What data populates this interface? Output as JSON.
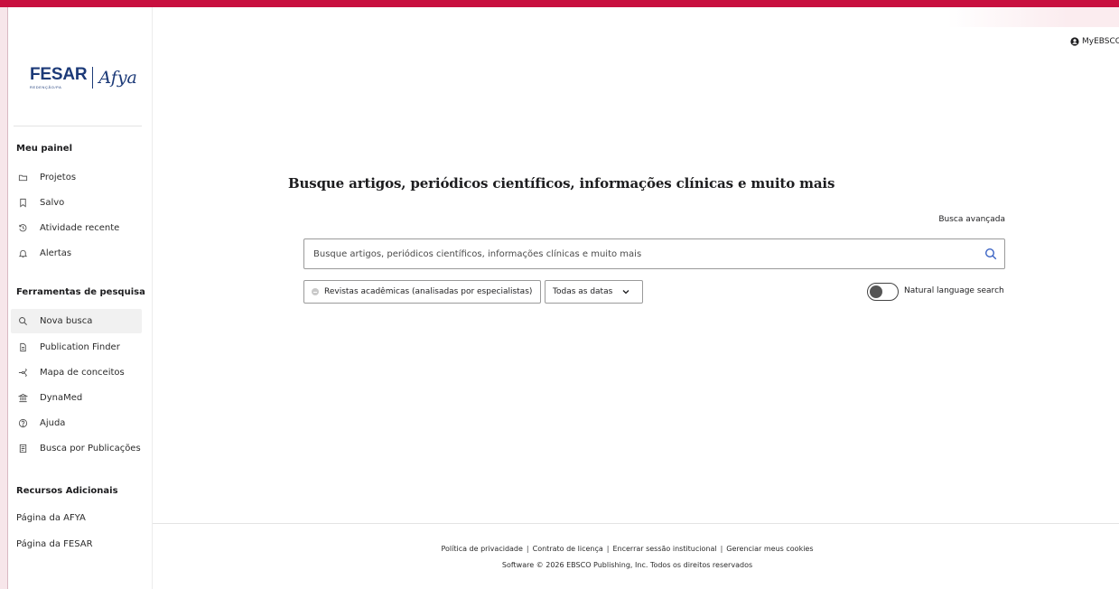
{
  "brand": {
    "logo_primary": "FESAR",
    "logo_sub": "REDENÇÃO/PA",
    "logo_secondary": "Afya",
    "accent_color": "#c8103f",
    "link_color": "#3b63c4"
  },
  "header": {
    "account_label": "MyEBSCO"
  },
  "sidebar": {
    "panel_heading": "Meu painel",
    "panel_items": [
      {
        "label": "Projetos",
        "icon": "folder-icon"
      },
      {
        "label": "Salvo",
        "icon": "bookmark-icon"
      },
      {
        "label": "Atividade recente",
        "icon": "history-icon"
      },
      {
        "label": "Alertas",
        "icon": "bell-icon"
      }
    ],
    "tools_heading": "Ferramentas de pesquisa",
    "tools_items": [
      {
        "label": "Nova busca",
        "icon": "search-icon",
        "active": true
      },
      {
        "label": "Publication Finder",
        "icon": "document-icon"
      },
      {
        "label": "Mapa de conceitos",
        "icon": "concept-map-icon"
      },
      {
        "label": "DynaMed",
        "icon": "institution-icon"
      },
      {
        "label": "Ajuda",
        "icon": "help-icon"
      },
      {
        "label": "Busca por Publicações",
        "icon": "publication-icon"
      }
    ],
    "resources_heading": "Recursos Adicionais",
    "resources_links": [
      {
        "label": "Página da AFYA"
      },
      {
        "label": "Página da FESAR"
      }
    ]
  },
  "main": {
    "title": "Busque artigos, periódicos científicos, informações clínicas e muito mais",
    "advanced_search": "Busca avançada",
    "search": {
      "placeholder": "Busque artigos, periódicos científicos, informações clínicas e muito mais",
      "value": ""
    },
    "filters": {
      "peer_reviewed": "Revistas acadêmicas (analisadas por especialistas)",
      "dates": "Todas as datas"
    },
    "natural_language": {
      "label": "Natural language search",
      "enabled": false
    }
  },
  "footer": {
    "links": [
      "Política de privacidade",
      "Contrato de licença",
      "Encerrar sessão institucional",
      "Gerenciar meus cookies"
    ],
    "copyright": "Software © 2026 EBSCO Publishing, Inc. Todos os direitos reservados"
  }
}
